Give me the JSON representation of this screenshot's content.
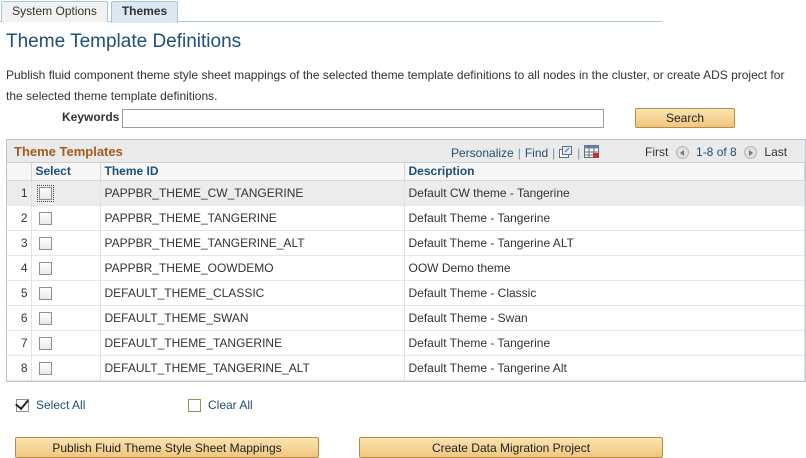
{
  "tabs": [
    {
      "label": "System Options",
      "active": false
    },
    {
      "label": "Themes",
      "active": true
    }
  ],
  "page_title": "Theme Template Definitions",
  "description": "Publish fluid component theme style sheet mappings of the selected theme template definitions to all nodes in the cluster, or create ADS project for the selected theme template definitions.",
  "search": {
    "keywords_label": "Keywords",
    "keywords_value": "",
    "search_button": "Search"
  },
  "grid": {
    "title": "Theme Templates",
    "personalize": "Personalize",
    "find": "Find",
    "pager_first": "First",
    "pager_range": "1-8 of 8",
    "pager_last": "Last",
    "columns": {
      "select": "Select",
      "theme_id": "Theme ID",
      "description": "Description"
    },
    "rows": [
      {
        "num": "1",
        "theme_id": "PAPPBR_THEME_CW_TANGERINE",
        "description": "Default CW theme - Tangerine"
      },
      {
        "num": "2",
        "theme_id": "PAPPBR_THEME_TANGERINE",
        "description": "Default Theme - Tangerine"
      },
      {
        "num": "3",
        "theme_id": "PAPPBR_THEME_TANGERINE_ALT",
        "description": "Default Theme - Tangerine ALT"
      },
      {
        "num": "4",
        "theme_id": "PAPPBR_THEME_OOWDEMO",
        "description": "OOW Demo theme"
      },
      {
        "num": "5",
        "theme_id": "DEFAULT_THEME_CLASSIC",
        "description": "Default Theme - Classic"
      },
      {
        "num": "6",
        "theme_id": "DEFAULT_THEME_SWAN",
        "description": "Default Theme - Swan"
      },
      {
        "num": "7",
        "theme_id": "DEFAULT_THEME_TANGERINE",
        "description": "Default Theme - Tangerine"
      },
      {
        "num": "8",
        "theme_id": "DEFAULT_THEME_TANGERINE_ALT",
        "description": "Default Theme - Tangerine Alt"
      }
    ]
  },
  "select_all": "Select All",
  "clear_all": "Clear All",
  "buttons": {
    "publish": "Publish Fluid Theme Style Sheet Mappings",
    "create_ads": "Create Data Migration Project"
  },
  "icons": {
    "new_window": "new-window-icon",
    "download": "download-spreadsheet-icon",
    "first_arrow": "previous-arrow-icon",
    "last_arrow": "next-arrow-icon"
  },
  "colors": {
    "title_blue": "#1f4e79",
    "grid_title_orange": "#a25d1b",
    "button_gold": "#f1c77d"
  }
}
